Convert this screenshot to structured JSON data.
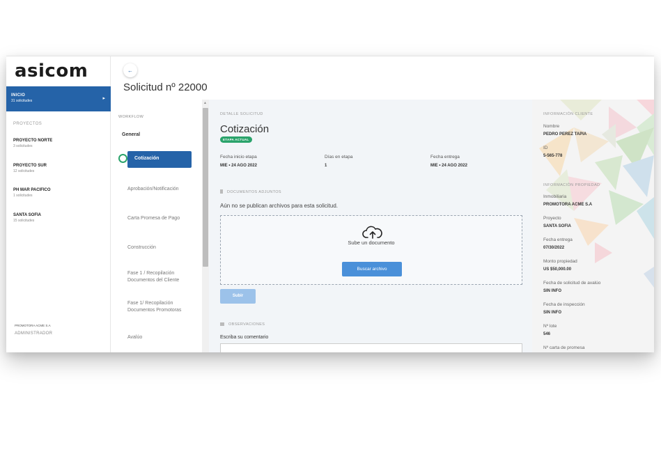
{
  "brand": {
    "logo": "asicom"
  },
  "sidebar": {
    "inicio": {
      "label": "INICIO",
      "count": "31 solicitudes"
    },
    "section_label": "PROYECTOS",
    "projects": [
      {
        "name": "PROYECTO NORTE",
        "count": "3 solicitudes"
      },
      {
        "name": "PROYECTO SUR",
        "count": "12 solicitudes"
      },
      {
        "name": "PH MAR PACIFICO",
        "count": "1 solicitudes"
      },
      {
        "name": "SANTA SOFIA",
        "count": "15 solicitudes"
      }
    ],
    "company": "PROMOTORA ACME S.A",
    "role": "ADMINISTRADOR"
  },
  "header": {
    "title": "Solicitud nº 22000"
  },
  "workflow": {
    "label": "WORKFLOW",
    "general": "General",
    "active": "Cotización",
    "steps": [
      "Aprobación/Notificación",
      "Carta Promesa de Pago",
      "Construcción",
      "Fase 1 / Recopilación Documentos del Cliente",
      "Fase 1/ Recopilación Documentos Promotoras",
      "Avalúo"
    ]
  },
  "detail": {
    "section_label": "DETALLE SOLICITUD",
    "stage_title": "Cotización",
    "badge": "ETAPA ACTUAL",
    "fields": [
      {
        "label": "Fecha inicio etapa",
        "value": "MIE • 24 AGO 2022"
      },
      {
        "label": "Días en etapa",
        "value": "1"
      },
      {
        "label": "Fecha entrega",
        "value": "MIE • 24 AGO 2022"
      }
    ],
    "docs_label": "DOCUMENTOS ADJUNTOS",
    "no_files": "Aún no se publican archivos para esta solicitud.",
    "upload_text": "Sube un documento",
    "find_button": "Buscar archivo",
    "submit_button": "Subir",
    "obs_label": "OBSERVACIONES",
    "comment_label": "Escriba su comentario"
  },
  "client": {
    "section_label": "INFORMACIÓN CLIENTE",
    "items": [
      {
        "label": "Nombre",
        "value": "PEDRO PEREZ TAPIA"
      },
      {
        "label": "ID",
        "value": "5-565-778"
      }
    ]
  },
  "property": {
    "section_label": "INFORMACIÓN PROPIEDAD",
    "items": [
      {
        "label": "Inmobiliaria",
        "value": "PROMOTORA ACME S.A"
      },
      {
        "label": "Proyecto",
        "value": "SANTA SOFIA"
      },
      {
        "label": "Fecha entrega",
        "value": "07/30/2022"
      },
      {
        "label": "Monto propiedad",
        "value": "US $50,000.00"
      },
      {
        "label": "Fecha de solicitud de avalúo",
        "value": "SIN INFO"
      },
      {
        "label": "Fecha de inspección",
        "value": "SIN INFO"
      },
      {
        "label": "Nº lote",
        "value": "546"
      },
      {
        "label": "Nº carta de promesa",
        "value": ""
      }
    ]
  },
  "colors": {
    "primary": "#2563a8",
    "success": "#2aa36b",
    "button": "#4a90d9"
  },
  "icons": {
    "back": "arrow-left-icon",
    "upload": "cloud-upload-icon",
    "docs": "document-icon",
    "comments": "comment-icon",
    "chevron": "chevron-right-icon"
  }
}
